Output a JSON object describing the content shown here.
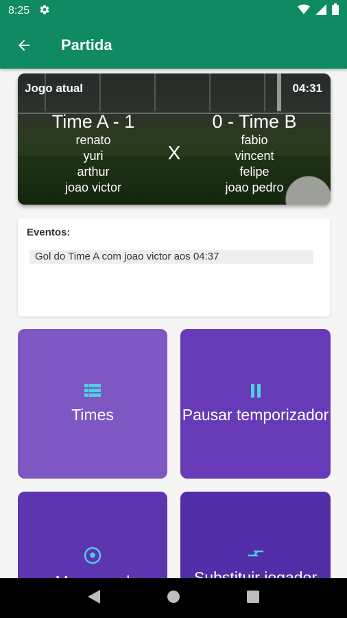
{
  "status_bar": {
    "time": "8:25"
  },
  "app_bar": {
    "title": "Partida"
  },
  "match": {
    "label": "Jogo atual",
    "clock": "04:31",
    "team_a": {
      "name": "Time A - 1",
      "players": [
        "renato",
        "yuri",
        "arthur",
        "joao victor"
      ]
    },
    "team_b": {
      "name": "0 - Time B",
      "players": [
        "fabio",
        "vincent",
        "felipe",
        "joao pedro"
      ]
    },
    "versus": "X"
  },
  "events": {
    "title": "Eventos:",
    "items": [
      "Gol do Time A com joao victor aos 04:37"
    ]
  },
  "actions": {
    "times": "Times",
    "pause": "Pausar temporizador",
    "goal": "Marcar gol",
    "substitute": "Substituir jogador"
  },
  "colors": {
    "primary": "#0f8a63",
    "tile_1": "#7e57c2",
    "tile_2": "#673ab7",
    "tile_3": "#5e35b1",
    "tile_4": "#512da8",
    "icon_accent": "#4dd0e1"
  }
}
